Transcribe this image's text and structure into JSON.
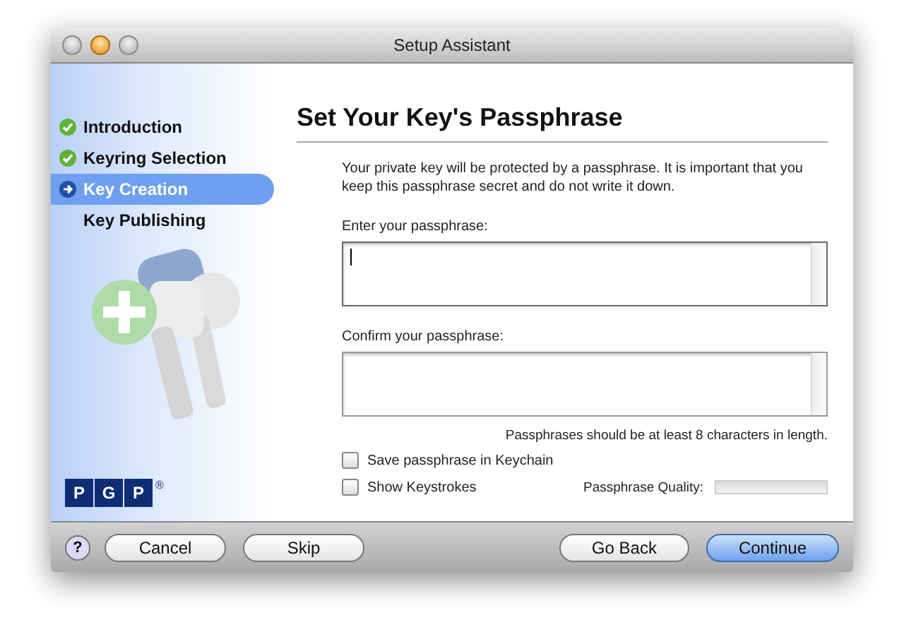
{
  "window": {
    "title": "Setup Assistant"
  },
  "steps": [
    {
      "label": "Introduction",
      "kind": "done",
      "selected": false
    },
    {
      "label": "Keyring Selection",
      "kind": "done",
      "selected": false
    },
    {
      "label": "Key Creation",
      "kind": "current",
      "selected": true
    },
    {
      "label": "Key Publishing",
      "kind": "pending",
      "selected": false
    }
  ],
  "logo": {
    "letters": [
      "P",
      "G",
      "P"
    ],
    "mark": "®"
  },
  "page": {
    "title": "Set Your Key's Passphrase",
    "intro": "Your private key will be protected by a passphrase. It is important that you keep this passphrase secret and do not write it down.",
    "fields": [
      {
        "label": "Enter your passphrase:",
        "focused": true
      },
      {
        "label": "Confirm your passphrase:",
        "focused": false
      }
    ],
    "hint": "Passphrases should be at least 8 characters in length.",
    "checkboxes": [
      {
        "label": "Save passphrase in Keychain",
        "checked": false
      },
      {
        "label": "Show Keystrokes",
        "checked": false
      }
    ],
    "quality": {
      "label": "Passphrase Quality:",
      "level": 0
    }
  },
  "footer": {
    "help": "?",
    "left_buttons": [
      {
        "label": "Cancel",
        "default": false
      },
      {
        "label": "Skip",
        "default": false
      }
    ],
    "right_buttons": [
      {
        "label": "Go Back",
        "default": false
      },
      {
        "label": "Continue",
        "default": true
      }
    ]
  }
}
